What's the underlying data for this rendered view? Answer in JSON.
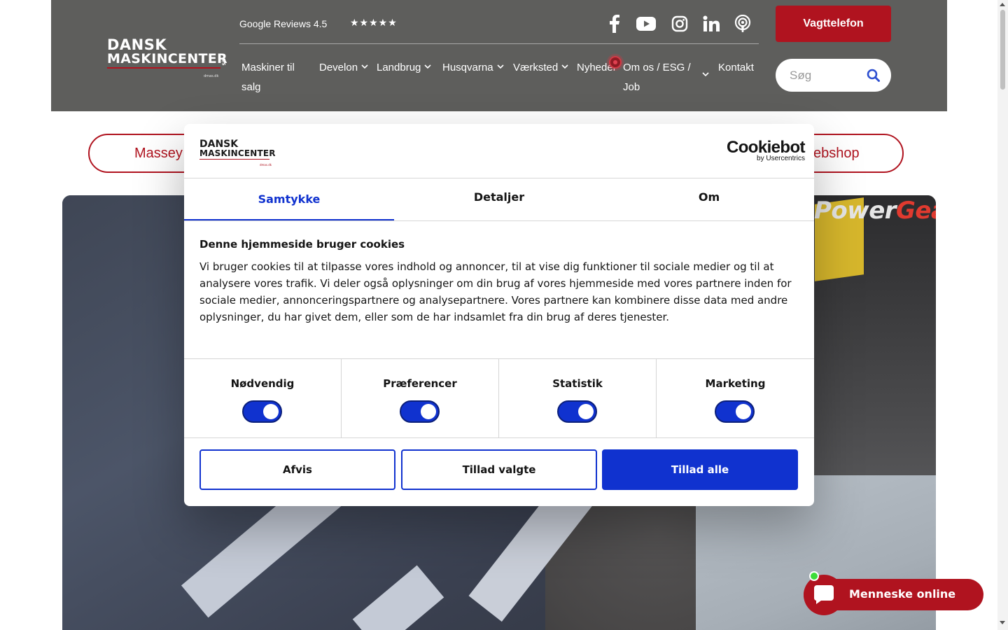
{
  "header": {
    "logo_line1": "DANSK",
    "logo_line2": "MASKINCENTER",
    "logo_suffix": "A/S",
    "logo_small": "dmas.dk",
    "reviews_label": "Google Reviews 4.5",
    "stars": "★★★★★",
    "social": [
      "facebook-icon",
      "youtube-icon",
      "instagram-icon",
      "linkedin-icon",
      "podcast-icon"
    ],
    "cta_label": "Vagttelefon",
    "search_placeholder": "Søg",
    "nav": [
      {
        "label": "Maskiner til salg",
        "dropdown": false
      },
      {
        "label": "Develon",
        "dropdown": true
      },
      {
        "label": "Landbrug",
        "dropdown": true
      },
      {
        "label": "Husqvarna",
        "dropdown": true
      },
      {
        "label": "Værksted",
        "dropdown": true
      },
      {
        "label": "Nyheder",
        "dropdown": false
      },
      {
        "label": "Om os / ESG / Job",
        "dropdown": true
      },
      {
        "label": "Kontakt",
        "dropdown": false
      }
    ]
  },
  "page": {
    "pill_left": "Massey",
    "pill_right": "ebshop",
    "hero_brand_a": "Power",
    "hero_brand_b": "Gear"
  },
  "dialog": {
    "logo_line1": "DANSK",
    "logo_line2": "MASKINCENTER",
    "logo_suffix": "A/S",
    "logo_small": "dmas.dk",
    "provider_name": "Cookiebot",
    "provider_by": "by Usercentrics",
    "tabs": [
      "Samtykke",
      "Detaljer",
      "Om"
    ],
    "active_tab": "Samtykke",
    "title": "Denne hjemmeside bruger cookies",
    "text": "Vi bruger cookies til at tilpasse vores indhold og annoncer, til at vise dig funktioner til sociale medier og til at analysere vores trafik. Vi deler også oplysninger om din brug af vores hjemmeside med vores partnere inden for sociale medier, annonceringspartnere og analysepartnere. Vores partnere kan kombinere disse data med andre oplysninger, du har givet dem, eller som de har indsamlet fra din brug af deres tjenester.",
    "toggles": [
      {
        "label": "Nødvendig",
        "on": true
      },
      {
        "label": "Præferencer",
        "on": true
      },
      {
        "label": "Statistik",
        "on": true
      },
      {
        "label": "Marketing",
        "on": true
      }
    ],
    "buttons": {
      "reject": "Afvis",
      "allow_selected": "Tillad valgte",
      "allow_all": "Tillad alle"
    }
  },
  "chat": {
    "label": "Menneske online"
  },
  "colors": {
    "header_bg": "#5e5e5c",
    "brand_red": "#b0131f",
    "cookiebot_blue": "#1032cf",
    "online_green": "#3ddc38"
  }
}
